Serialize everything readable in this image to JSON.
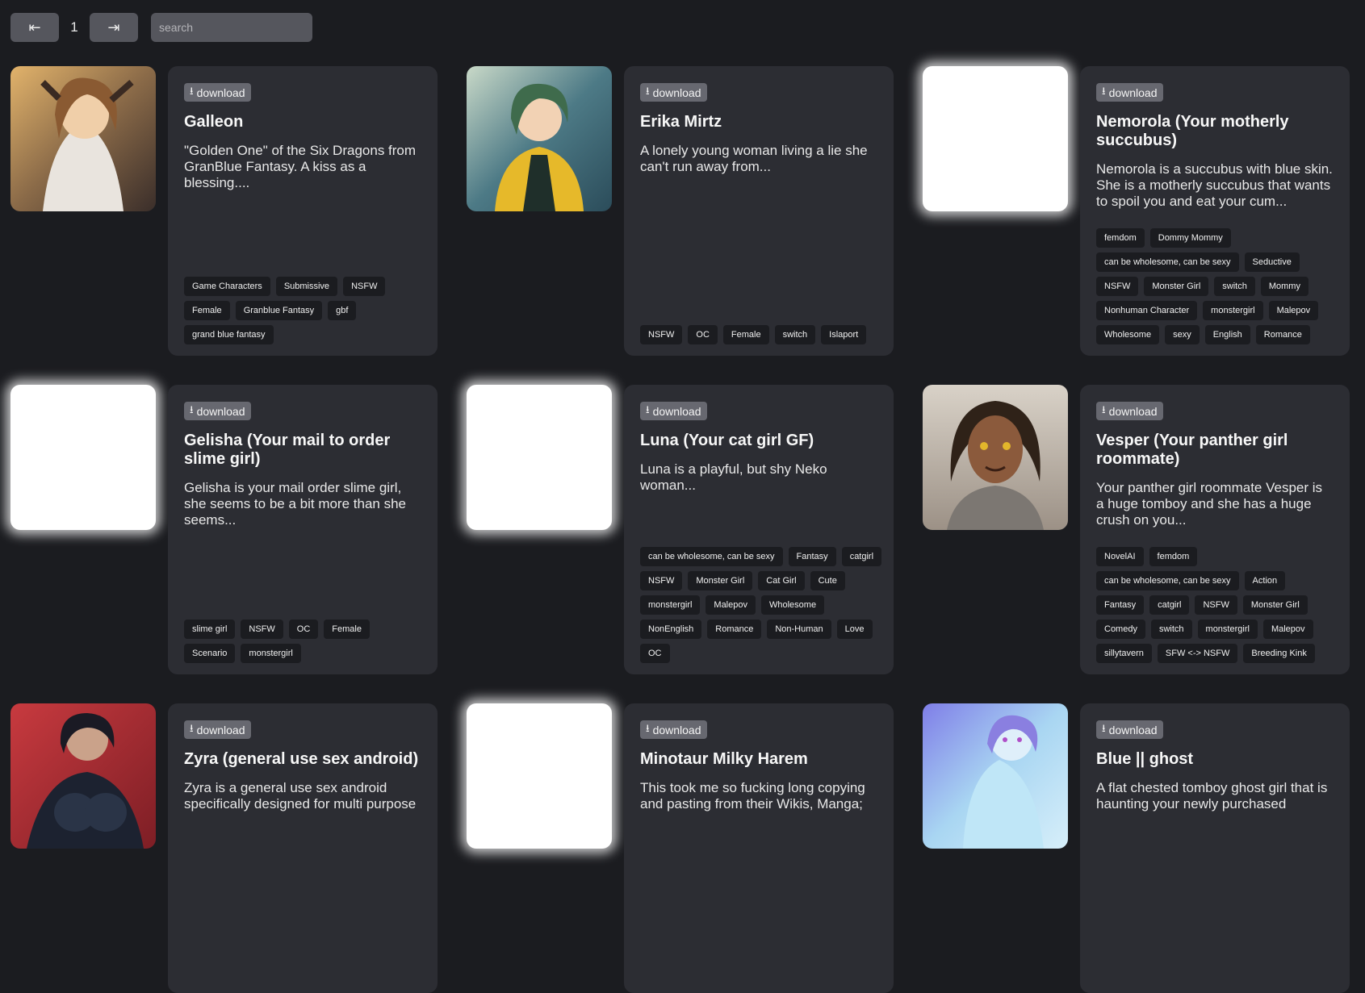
{
  "pagination": {
    "prev_icon": "⇤",
    "page": "1",
    "next_icon": "⇥"
  },
  "search": {
    "placeholder": "search",
    "value": ""
  },
  "download_label": "download",
  "cards": [
    {
      "image": "avatar-galleon",
      "title": "Galleon",
      "description": "\"Golden One\" of the Six Dragons from GranBlue Fantasy. A kiss as a blessing....",
      "tags": [
        "Game Characters",
        "Submissive",
        "NSFW",
        "Female",
        "Granblue Fantasy",
        "gbf",
        "grand blue fantasy"
      ]
    },
    {
      "image": "avatar-erika-mirtz",
      "title": "Erika Mirtz",
      "description": "A lonely young woman living a lie she can't run away from...",
      "tags": [
        "NSFW",
        "OC",
        "Female",
        "switch",
        "Islaport"
      ]
    },
    {
      "image": "blurred",
      "title": "Nemorola (Your motherly succubus)",
      "description": "Nemorola is a succubus with blue skin. She is a motherly succubus that wants to spoil you and eat your cum...",
      "tags": [
        "femdom",
        "Dommy Mommy",
        "can be wholesome, can be sexy",
        "Seductive",
        "NSFW",
        "Monster Girl",
        "switch",
        "Mommy",
        "Nonhuman Character",
        "monstergirl",
        "Malepov",
        "Wholesome",
        "sexy",
        "English",
        "Romance"
      ]
    },
    {
      "image": "blurred",
      "title": "Gelisha (Your mail to order slime girl)",
      "description": "Gelisha is your mail order slime girl, she seems to be a bit more than she seems...",
      "tags": [
        "slime girl",
        "NSFW",
        "OC",
        "Female",
        "Scenario",
        "monstergirl"
      ]
    },
    {
      "image": "blurred",
      "title": "Luna (Your cat girl GF)",
      "description": "Luna is a playful, but shy Neko woman...",
      "tags": [
        "can be wholesome, can be sexy",
        "Fantasy",
        "catgirl",
        "NSFW",
        "Monster Girl",
        "Cat Girl",
        "Cute",
        "monstergirl",
        "Malepov",
        "Wholesome",
        "NonEnglish",
        "Romance",
        "Non-Human",
        "Love",
        "OC"
      ]
    },
    {
      "image": "avatar-vesper",
      "title": "Vesper (Your panther girl roommate)",
      "description": "Your panther girl roommate Vesper is a huge tomboy and she has a huge crush on you...",
      "tags": [
        "NovelAI",
        "femdom",
        "can be wholesome, can be sexy",
        "Action",
        "Fantasy",
        "catgirl",
        "NSFW",
        "Monster Girl",
        "Comedy",
        "switch",
        "monstergirl",
        "Malepov",
        "sillytavern",
        "SFW <-> NSFW",
        "Breeding Kink"
      ]
    },
    {
      "image": "avatar-zyra",
      "title": "Zyra (general use sex android)",
      "description": "Zyra is a general use sex android specifically designed for multi purpose",
      "tags": []
    },
    {
      "image": "blurred",
      "title": "Minotaur Milky Harem",
      "description": "This took me so fucking long copying and pasting from their Wikis, Manga;",
      "tags": []
    },
    {
      "image": "avatar-blue-ghost",
      "title": "Blue || ghost",
      "description": "A flat chested tomboy ghost girl that is haunting your newly purchased",
      "tags": []
    }
  ]
}
